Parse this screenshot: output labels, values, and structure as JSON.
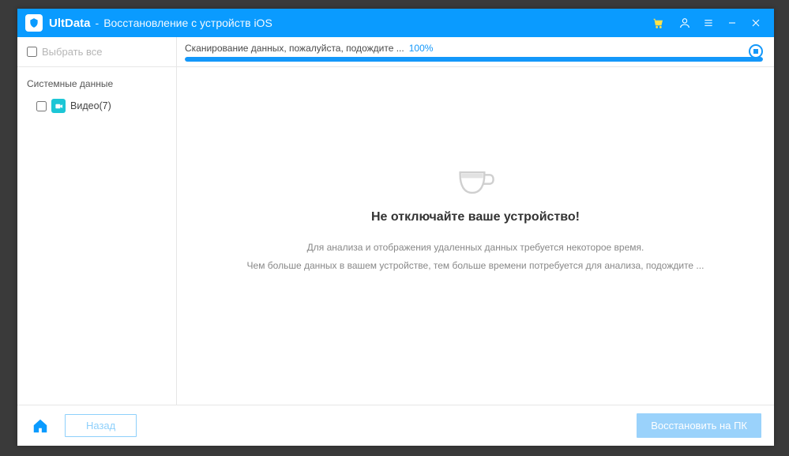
{
  "titlebar": {
    "app_name": "UltData",
    "separator": "-",
    "subtitle": "Восстановление с устройств iOS"
  },
  "toolbar": {
    "select_all_label": "Выбрать все",
    "scan_label": "Сканирование данных, пожалуйста, подождите ...",
    "scan_percent": "100%",
    "progress_fill": 100
  },
  "sidebar": {
    "group_title": "Системные данные",
    "items": [
      {
        "label": "Видео(7)",
        "icon": "video"
      }
    ]
  },
  "main": {
    "heading": "Не отключайте ваше устройство!",
    "line1": "Для анализа и отображения удаленных данных требуется некоторое время.",
    "line2": "Чем больше данных в вашем устройстве, тем больше времени потребуется для анализа, подождите ..."
  },
  "footer": {
    "back_label": "Назад",
    "recover_label": "Восстановить на ПК"
  }
}
